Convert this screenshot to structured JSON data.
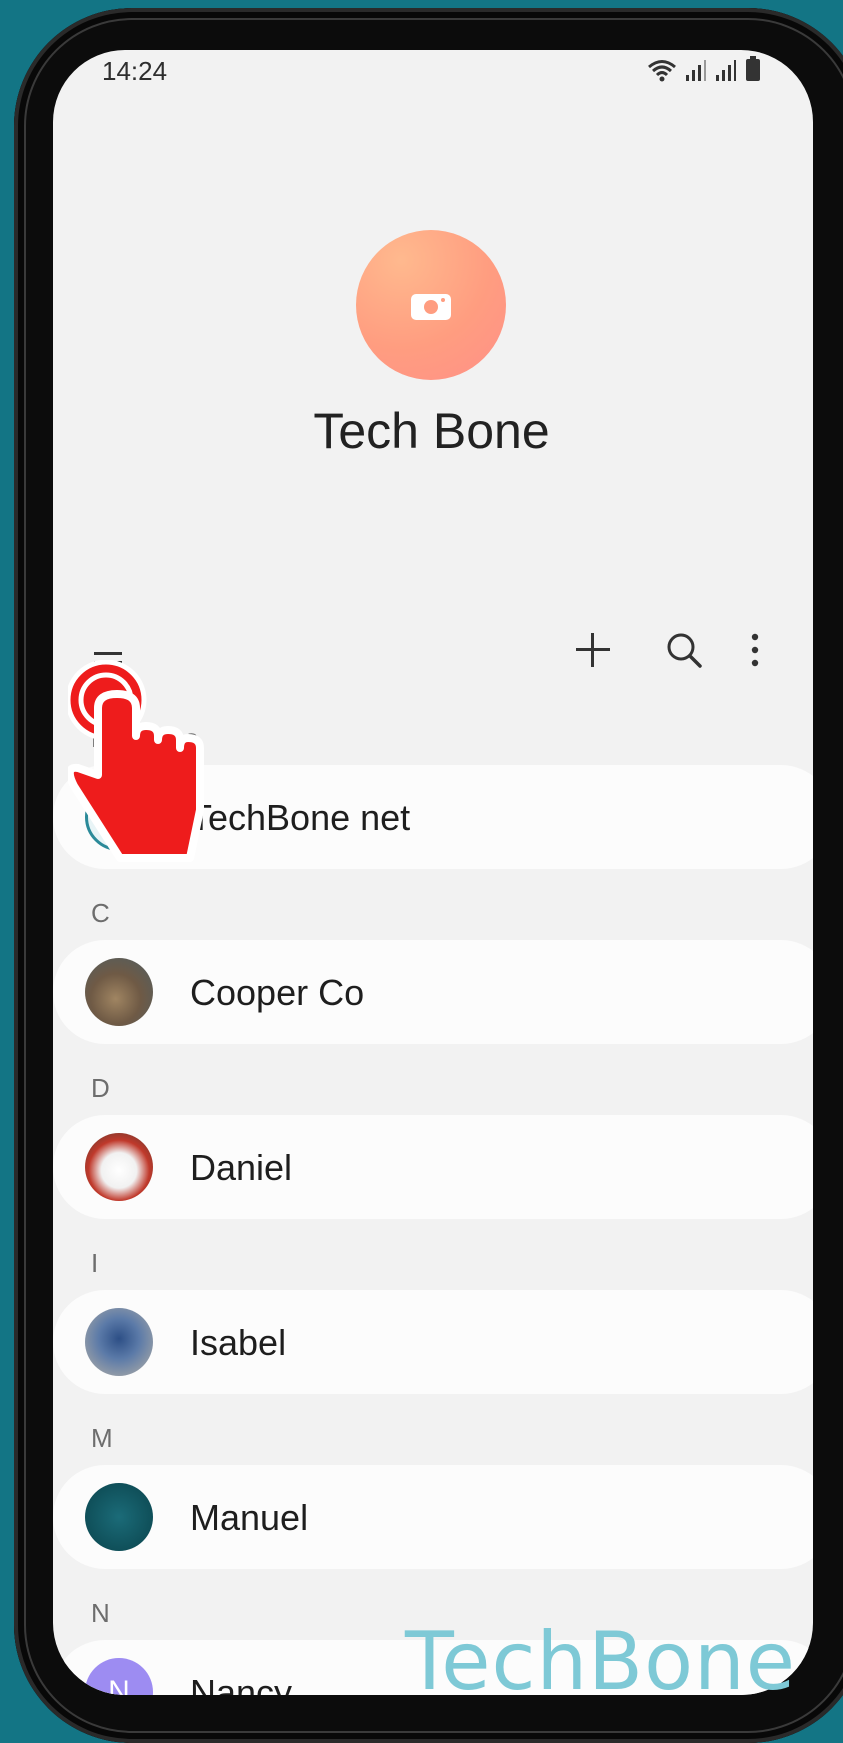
{
  "status": {
    "time": "14:24"
  },
  "profile": {
    "name": "Tech Bone",
    "avatar_icon": "camera-icon",
    "avatar_colors": [
      "#ffb98e",
      "#ff9087"
    ]
  },
  "toolbar": {
    "menu_icon": "hamburger-menu-icon",
    "add_icon": "plus-icon",
    "search_icon": "search-icon",
    "more_icon": "more-vertical-icon"
  },
  "favorites": {
    "label": "Favorites",
    "items": [
      {
        "name": "TechBone net"
      }
    ]
  },
  "sections": [
    {
      "letter": "C",
      "contacts": [
        {
          "name": "Cooper Co",
          "avatar_color": "#8a7a66"
        }
      ]
    },
    {
      "letter": "D",
      "contacts": [
        {
          "name": "Daniel",
          "avatar_color": "#c0392b"
        }
      ]
    },
    {
      "letter": "I",
      "contacts": [
        {
          "name": "Isabel",
          "avatar_color": "#5b7aa8"
        }
      ]
    },
    {
      "letter": "M",
      "contacts": [
        {
          "name": "Manuel",
          "avatar_color": "#0f4f59"
        }
      ]
    },
    {
      "letter": "N",
      "contacts": [
        {
          "name": "Nancy",
          "avatar_initial": "N",
          "avatar_color": "#9d8cf2"
        }
      ]
    }
  ],
  "watermark": "TechBone",
  "accent_colors": {
    "tap_indicator": "#ee1c1c",
    "background": "#137585"
  }
}
